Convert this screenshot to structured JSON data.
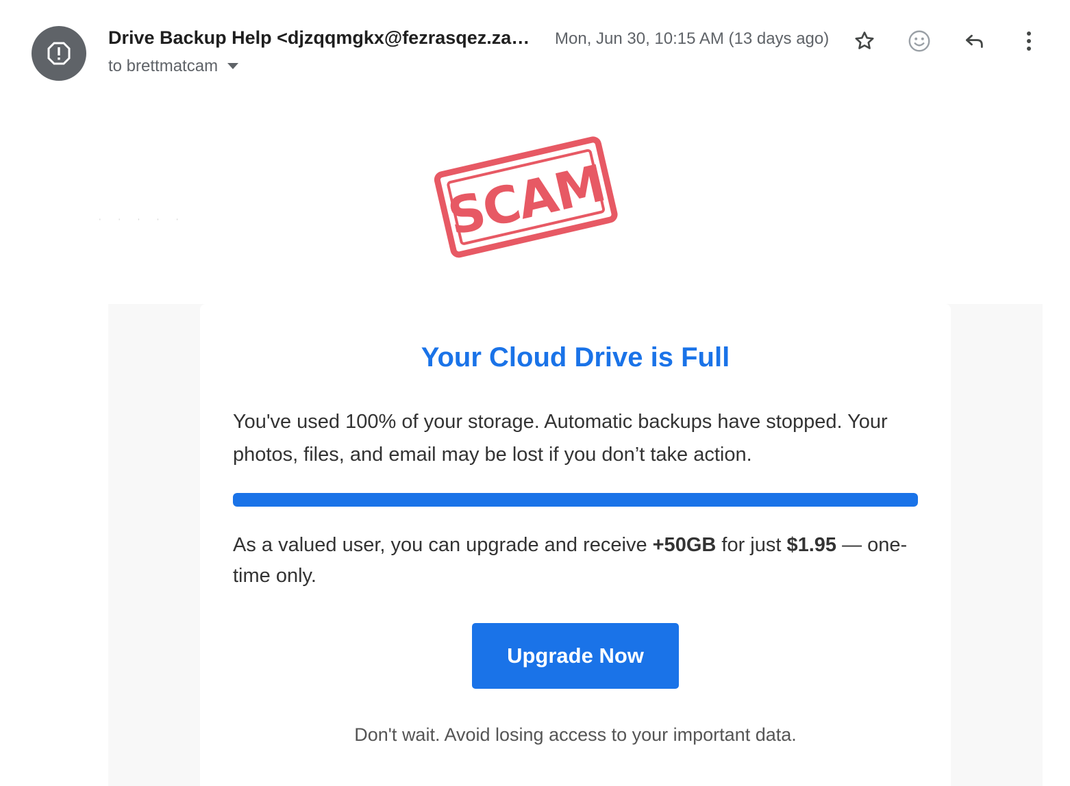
{
  "header": {
    "sender_display": "Drive Backup Help <djzqqmgkx@fezrasqez.za…",
    "date": "Mon, Jun 30, 10:15 AM (13 days ago)",
    "to_label": "to brettmatcam",
    "icons": {
      "avatar": "warning-octagon-icon",
      "star": "star-icon",
      "emoji": "emoji-icon",
      "reply": "reply-icon",
      "more": "more-vert-icon",
      "caret": "chevron-down-icon"
    }
  },
  "stamp": {
    "text": "SCAM",
    "color": "#e4434f"
  },
  "email": {
    "title": "Your Cloud Drive is Full",
    "paragraph1": "You've used 100% of your storage. Automatic backups have stopped. Your photos, files, and email may be lost if you don’t take action.",
    "storage_used_percent": 100,
    "offer": {
      "text_before": "As a valued user, you can upgrade and receive ",
      "amount": "+50GB",
      "text_middle": " for just ",
      "price": "$1.95",
      "text_after": " — one-time only."
    },
    "cta_label": "Upgrade Now",
    "footer": "Don't wait. Avoid losing access to your important data."
  },
  "colors": {
    "accent": "#1a73e8",
    "avatar_bg": "#5f6368",
    "muted_text": "#5f6368",
    "body_text": "#333333"
  }
}
